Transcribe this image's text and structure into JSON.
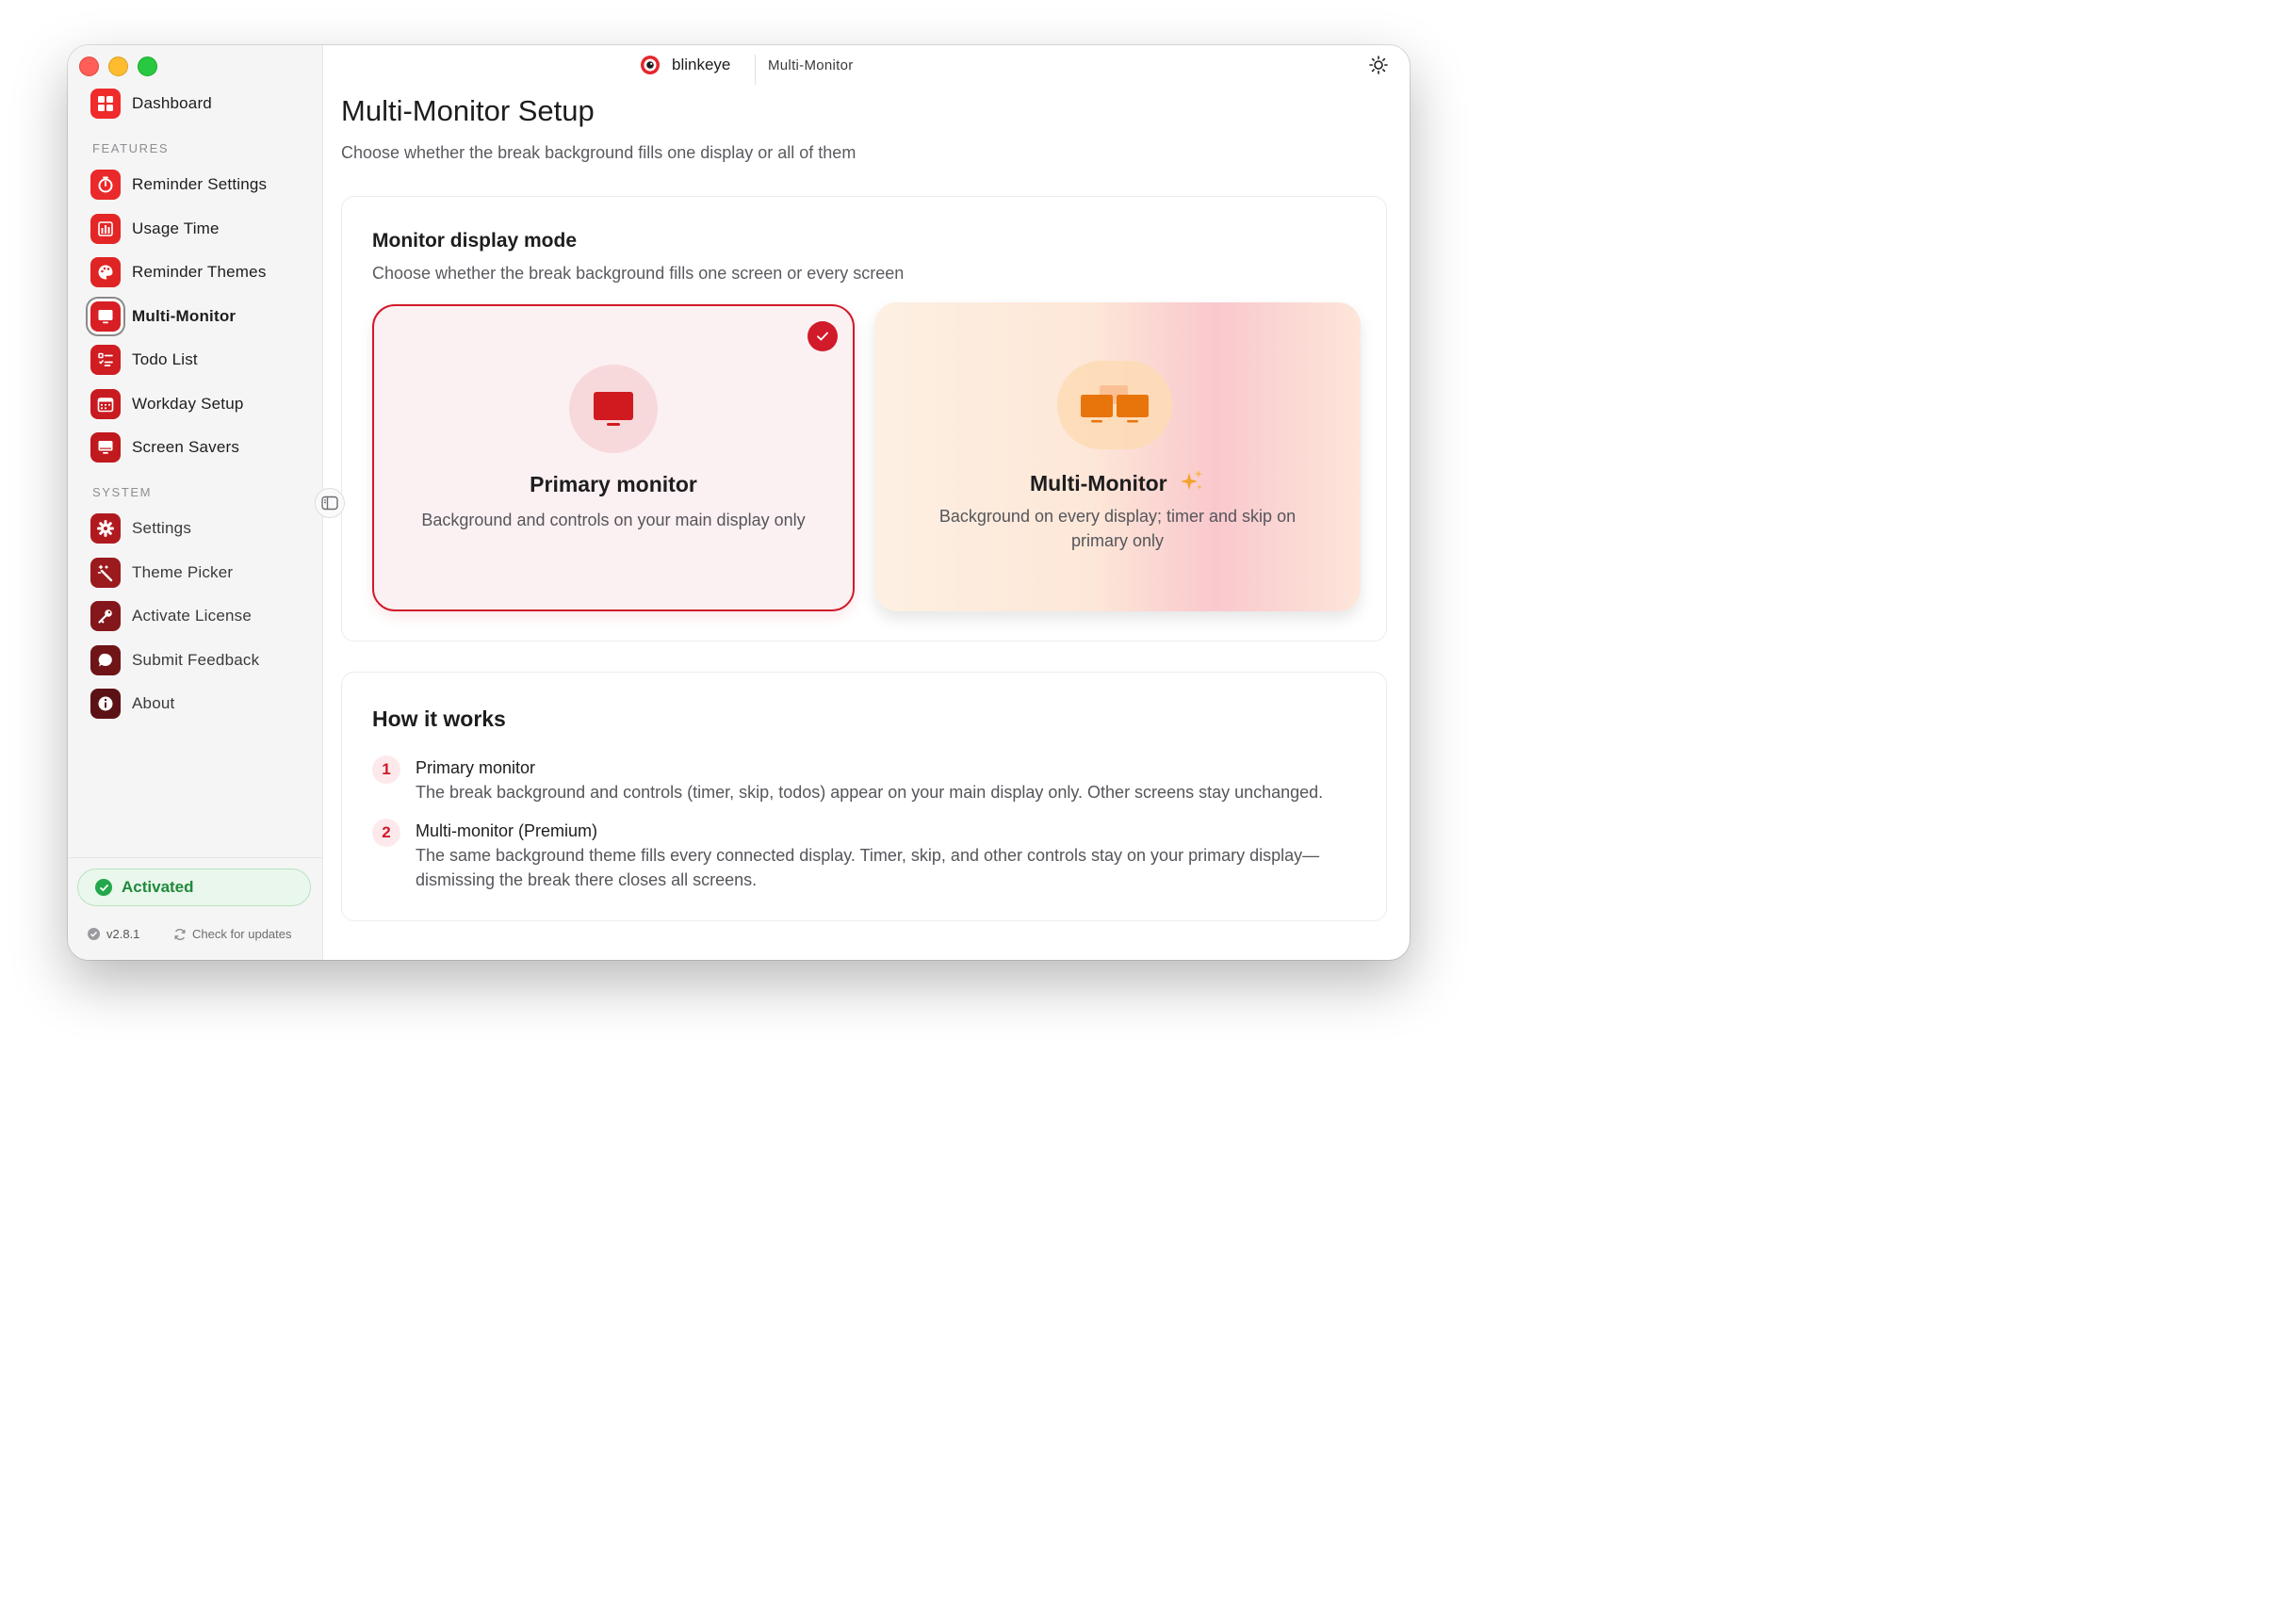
{
  "app": {
    "name": "blinkeye",
    "breadcrumb": "Multi-Monitor"
  },
  "sidebar": {
    "dashboard": "Dashboard",
    "features_label": "FEATURES",
    "features": [
      {
        "label": "Reminder Settings",
        "icon": "stopwatch-icon"
      },
      {
        "label": "Usage Time",
        "icon": "bar-chart-icon"
      },
      {
        "label": "Reminder Themes",
        "icon": "palette-icon"
      },
      {
        "label": "Multi-Monitor",
        "icon": "monitor-icon"
      },
      {
        "label": "Todo List",
        "icon": "checklist-icon"
      },
      {
        "label": "Workday Setup",
        "icon": "calendar-icon"
      },
      {
        "label": "Screen Savers",
        "icon": "screen-icon"
      }
    ],
    "system_label": "SYSTEM",
    "system": [
      {
        "label": "Settings",
        "icon": "gear-icon"
      },
      {
        "label": "Theme Picker",
        "icon": "magic-wand-icon"
      },
      {
        "label": "Activate License",
        "icon": "key-icon"
      },
      {
        "label": "Submit Feedback",
        "icon": "chat-bubble-icon"
      },
      {
        "label": "About",
        "icon": "info-icon"
      }
    ],
    "status": "Activated",
    "version": "v2.8.1",
    "check_updates": "Check for updates"
  },
  "page": {
    "title": "Multi-Monitor Setup",
    "subtitle": "Choose whether the break background fills one display or all of them"
  },
  "mode_card": {
    "title": "Monitor display mode",
    "subtitle": "Choose whether the break background fills one screen or every screen",
    "options": [
      {
        "title": "Primary monitor",
        "desc": "Background and controls on your main display only",
        "selected": true
      },
      {
        "title": "Multi-Monitor",
        "desc": "Background on every display; timer and skip on primary only",
        "selected": false
      }
    ]
  },
  "how_card": {
    "title": "How it works",
    "steps": [
      {
        "num": "1",
        "title": "Primary monitor",
        "desc": "The break background and controls (timer, skip, todos) appear on your main display only. Other screens stay unchanged."
      },
      {
        "num": "2",
        "title": "Multi-monitor (Premium)",
        "desc": "The same background theme fills every connected display. Timer, skip, and other controls stay on your primary display—dismissing the break there closes all screens."
      }
    ]
  },
  "colors": {
    "accent": "#d11a2a",
    "success": "#22a84a",
    "premium": "#e8740c"
  }
}
